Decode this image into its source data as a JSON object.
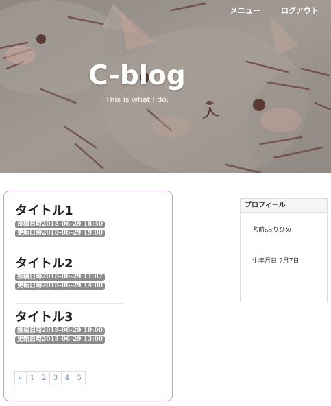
{
  "nav": {
    "menu_label": "メニュー",
    "logout_label": "ログアウト"
  },
  "hero": {
    "title": "C-blog",
    "subtitle": "This is what I do."
  },
  "posts": [
    {
      "title": "タイトル1",
      "posted": "投稿日時2018-06-29 18:30",
      "updated": "更新日時2018-06-29 19:00"
    },
    {
      "title": "タイトル2",
      "posted": "投稿日時2018-06-29 11:07",
      "updated": "更新日時2018-06-29 14:00"
    },
    {
      "title": "タイトル3",
      "posted": "投稿日時2018-06-29 10:00",
      "updated": "更新日時2018-06-29 13:00"
    }
  ],
  "pagination": {
    "prev": "«",
    "pages": [
      "1",
      "2",
      "3",
      "4",
      "5"
    ]
  },
  "profile": {
    "heading": "プロフィール",
    "name": "名前:おりひめ",
    "birthday": "生年月日:7月7日"
  },
  "colors": {
    "card_border": "#d69bd6",
    "badge_bg": "#8c8c8c",
    "link": "#6a8fc8"
  }
}
